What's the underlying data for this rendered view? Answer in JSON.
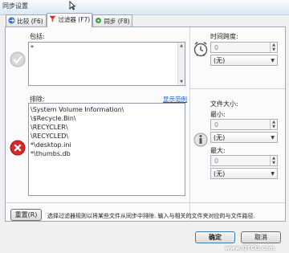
{
  "window": {
    "title": "同步设置"
  },
  "tabs": [
    {
      "label": "比较 (F6)"
    },
    {
      "label": "过滤器 (F7)"
    },
    {
      "label": "同步 (F8)"
    }
  ],
  "include": {
    "label": "包括:",
    "lines": [
      "*"
    ]
  },
  "exclude": {
    "label": "排除:",
    "show_examples": "显示范例",
    "lines": [
      "\\System Volume Information\\",
      "\\$Recycle.Bin\\",
      "\\RECYCLER\\",
      "\\RECYCLED\\",
      "*\\desktop.ini",
      "*\\thumbs.db"
    ]
  },
  "time_span": {
    "label": "时间跨度:",
    "value": "0",
    "unit": "(无)"
  },
  "file_size": {
    "label": "文件大小:",
    "min_label": "最小:",
    "min_value": "0",
    "min_unit": "(无)",
    "max_label": "最大:",
    "max_value": "0",
    "max_unit": "(无)"
  },
  "reset": {
    "label": "重置(R)",
    "description": "选择过滤器规则以将某些文件从同步中排除. 输入与相关的文件夹对应的与文件路径."
  },
  "footer": {
    "ok": "确定",
    "cancel": "取消"
  },
  "watermark": "www.QTCG.com"
}
